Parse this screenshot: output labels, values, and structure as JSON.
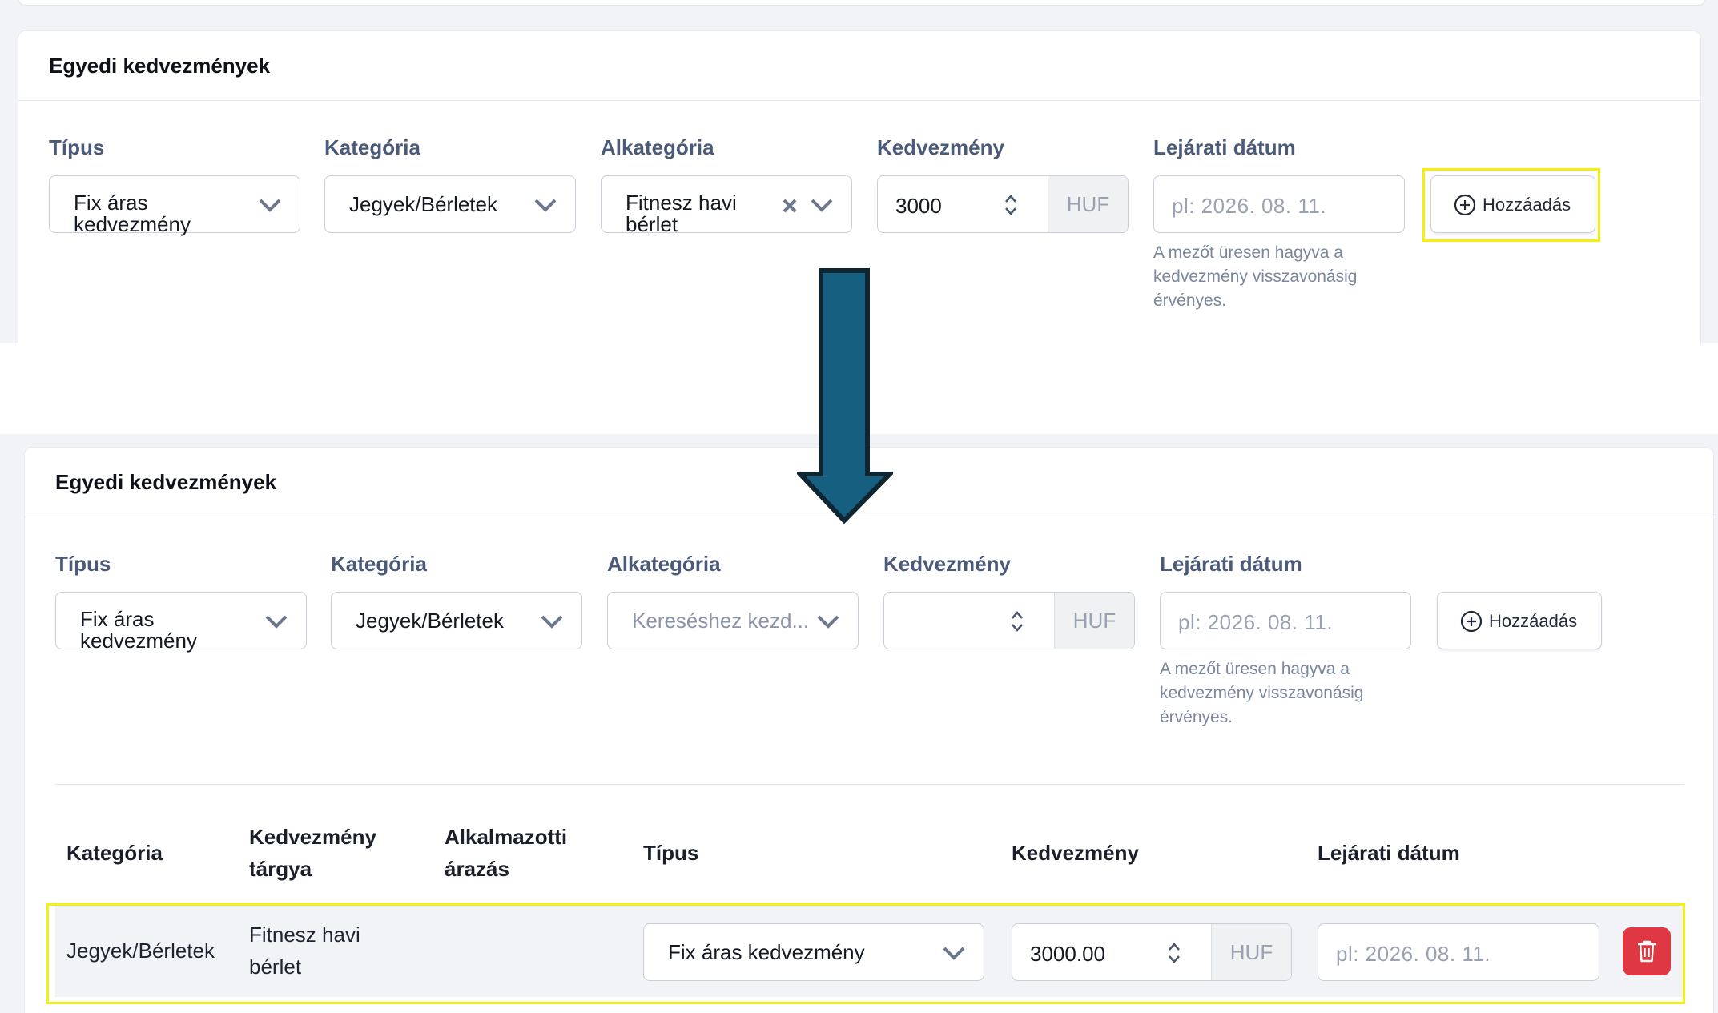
{
  "before": {
    "title": "Egyedi kedvezmények",
    "labels": {
      "type": "Típus",
      "category": "Kategória",
      "subcategory": "Alkategória",
      "discount": "Kedvezmény",
      "expiry": "Lejárati dátum"
    },
    "type_value": "Fix áras kedvezmény",
    "category_value": "Jegyek/Bérletek",
    "subcategory_value": "Fitnesz havi bérlet",
    "discount_value": "3000",
    "currency": "HUF",
    "expiry_placeholder": "pl: 2026. 08. 11.",
    "hint": "A mezőt üresen hagyva a kedvezmény visszavonásig érvényes.",
    "add_label": "Hozzáadás"
  },
  "after": {
    "title": "Egyedi kedvezmények",
    "labels": {
      "type": "Típus",
      "category": "Kategória",
      "subcategory": "Alkategória",
      "discount": "Kedvezmény",
      "expiry": "Lejárati dátum"
    },
    "type_value": "Fix áras kedvezmény",
    "category_value": "Jegyek/Bérletek",
    "subcategory_placeholder": "Kereséshez kezd...",
    "discount_value": "",
    "currency": "HUF",
    "expiry_placeholder": "pl: 2026. 08. 11.",
    "hint": "A mezőt üresen hagyva a kedvezmény visszavonásig érvényes.",
    "add_label": "Hozzáadás"
  },
  "table": {
    "headers": {
      "category": "Kategória",
      "subject": "Kedvezmény tárgya",
      "employee_pricing": "Alkalmazotti árazás",
      "type": "Típus",
      "discount": "Kedvezmény",
      "expiry": "Lejárati dátum"
    },
    "rows": [
      {
        "category": "Jegyek/Bérletek",
        "subject": "Fitnesz havi bérlet",
        "type": "Fix áras kedvezmény",
        "discount": "3000.00",
        "currency": "HUF",
        "expiry_placeholder": "pl: 2026. 08. 11."
      }
    ]
  },
  "colors": {
    "highlight": "#f2f10f",
    "arrow": "#165f80",
    "delete": "#e03842"
  }
}
